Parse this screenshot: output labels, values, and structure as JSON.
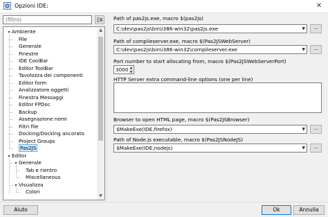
{
  "window": {
    "title": "Opzioni IDE:",
    "close_glyph": "✕"
  },
  "filter": {
    "placeholder": "(filtro)"
  },
  "tree": {
    "items": [
      {
        "label": "Ambiente",
        "level": 0,
        "expanded": true
      },
      {
        "label": "File",
        "level": 1
      },
      {
        "label": "Generale",
        "level": 1
      },
      {
        "label": "Finestre",
        "level": 1
      },
      {
        "label": "IDE CoolBar",
        "level": 1
      },
      {
        "label": "Editor ToolBar",
        "level": 1
      },
      {
        "label": "Tavolozza dei componenti",
        "level": 1
      },
      {
        "label": "Editor form",
        "level": 1
      },
      {
        "label": "Analizzatore oggetti",
        "level": 1
      },
      {
        "label": "Finestra Messaggi",
        "level": 1
      },
      {
        "label": "Editor FPDoc",
        "level": 1
      },
      {
        "label": "Backup",
        "level": 1
      },
      {
        "label": "Assegnazione nomi",
        "level": 1
      },
      {
        "label": "Filtri file",
        "level": 1
      },
      {
        "label": "Docking/Docking ancorato",
        "level": 1
      },
      {
        "label": "Project Groups",
        "level": 1
      },
      {
        "label": "Pas2JS",
        "level": 1,
        "selected": true
      },
      {
        "label": "Editor",
        "level": 0,
        "expanded": true
      },
      {
        "label": "Generale",
        "level": 1,
        "expanded": true
      },
      {
        "label": "Tab e rientro",
        "level": 2
      },
      {
        "label": "Miscellaneous",
        "level": 2
      },
      {
        "label": "Visualizza",
        "level": 1,
        "expanded": true
      },
      {
        "label": "Colori",
        "level": 2
      }
    ]
  },
  "settings": {
    "pas2js_label": "Path of pas2js.exe, macro $(pas2js)",
    "pas2js_value": "C:\\dev\\pas2js\\bin\\i386-win32\\pas2js.exe",
    "compileserver_label": "Path of compileserver.exe, macro $(Pas2JSWebServer)",
    "compileserver_value": "C:\\dev\\pas2js\\bin\\i386-win32\\compileserver.exe",
    "port_label": "Port number to start allocating from, macro $(Pas2JSWebServerPort)",
    "port_value": "3000",
    "http_options_label": "HTTP Server extra command-line options (one per line)",
    "browser_label": "Browser to open HTML page, macro $(Pas2JSBrowser)",
    "browser_value": "$MakeExe(IDE,firefox)",
    "nodejs_label": "Path of Node.js executable, macro $(Pas2JSNodeJS)",
    "nodejs_value": "$MakeExe(IDE,nodejs)",
    "browse_glyph": "..."
  },
  "buttons": {
    "help": "Aiuto",
    "ok": "Ok",
    "cancel": "Annulla"
  }
}
